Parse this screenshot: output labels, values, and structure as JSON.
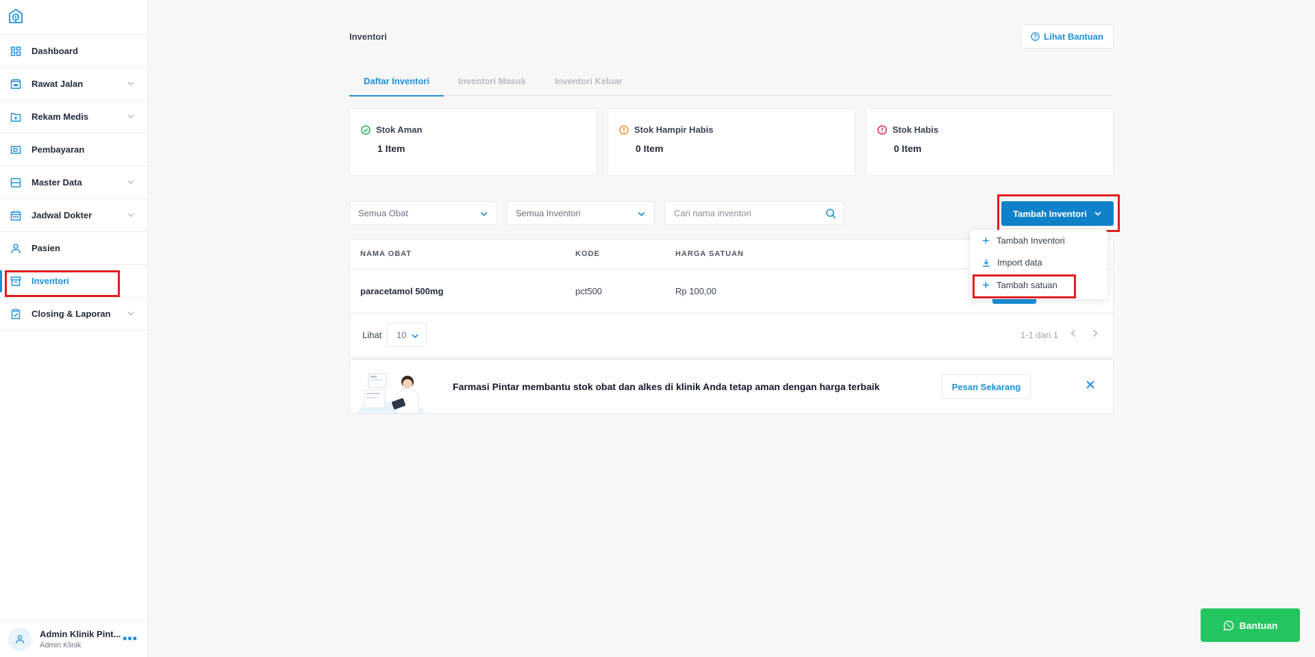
{
  "sidebar": {
    "logo_icon": "clinic-pin-icon",
    "items": [
      {
        "label": "Dashboard",
        "icon": "dashboard-icon",
        "has_children": false
      },
      {
        "label": "Rawat Jalan",
        "icon": "outpatient-icon",
        "has_children": true
      },
      {
        "label": "Rekam Medis",
        "icon": "medical-record-icon",
        "has_children": true
      },
      {
        "label": "Pembayaran",
        "icon": "payment-icon",
        "has_children": false
      },
      {
        "label": "Master Data",
        "icon": "database-icon",
        "has_children": true
      },
      {
        "label": "Jadwal Dokter",
        "icon": "calendar-icon",
        "has_children": true
      },
      {
        "label": "Pasien",
        "icon": "user-icon",
        "has_children": false
      },
      {
        "label": "Inventori",
        "icon": "archive-icon",
        "has_children": false,
        "active": true
      },
      {
        "label": "Closing & Laporan",
        "icon": "clipboard-check-icon",
        "has_children": true
      }
    ],
    "user": {
      "name": "Admin Klinik Pint...",
      "role": "Admin Klinik"
    }
  },
  "header": {
    "title": "Inventori",
    "help_label": "Lihat Bantuan"
  },
  "tabs": [
    {
      "label": "Daftar Inventori",
      "active": true
    },
    {
      "label": "Inventori Masuk"
    },
    {
      "label": "Inventori Keluar"
    }
  ],
  "stats": [
    {
      "title": "Stok Aman",
      "value": "1 Item",
      "color": "#22a94f",
      "icon": "check-circle-icon"
    },
    {
      "title": "Stok Hampir Habis",
      "value": "0 Item",
      "color": "#f08a24",
      "icon": "warning-circle-icon"
    },
    {
      "title": "Stok Habis",
      "value": "0 Item",
      "color": "#d61f5b",
      "icon": "alert-circle-icon"
    }
  ],
  "filters": {
    "obat": "Semua Obat",
    "inventori": "Semua Inventori",
    "search_placeholder": "Cari nama inventori"
  },
  "add_button": {
    "label": "Tambah Inventori"
  },
  "dropdown": {
    "items": [
      {
        "label": "Tambah Inventori",
        "icon": "plus-icon"
      },
      {
        "label": "Import data",
        "icon": "download-icon"
      },
      {
        "label": "Tambah satuan",
        "icon": "plus-icon"
      }
    ]
  },
  "table": {
    "headers": [
      "NAMA OBAT",
      "KODE",
      "HARGA SATUAN"
    ],
    "rows": [
      {
        "name": "paracetamol 500mg",
        "code": "pct500",
        "price": "Rp 100,00"
      }
    ],
    "footer": {
      "lihat": "Lihat",
      "page_size": "10",
      "page_info": "1-1 dari 1"
    }
  },
  "banner": {
    "text": "Farmasi Pintar membantu stok obat dan alkes di klinik Anda tetap aman dengan harga terbaik",
    "button": "Pesan Sekarang"
  },
  "whatsapp_button": {
    "label": "Bantuan"
  },
  "colors": {
    "accent": "#1d8fd8",
    "primary_button": "#0f81c9",
    "highlight": "#e31b1b",
    "whatsapp": "#23c55e"
  }
}
